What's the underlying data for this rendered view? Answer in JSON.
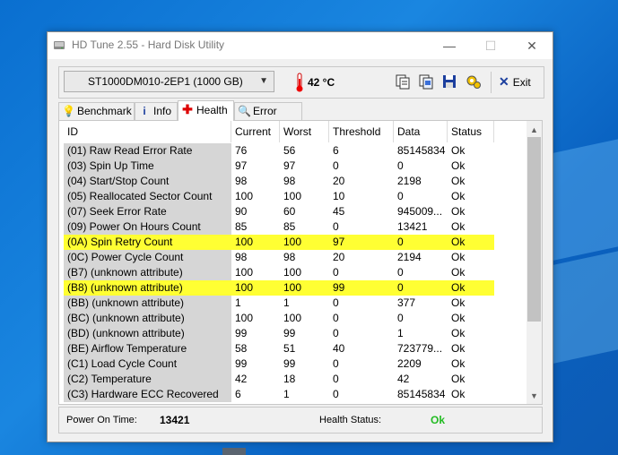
{
  "window": {
    "title": "HD Tune 2.55 - Hard Disk Utility",
    "minimize_glyph": "—",
    "maximize_glyph": "☐",
    "close_glyph": "✕"
  },
  "toolbar": {
    "drive": "ST1000DM010-2EP1 (1000 GB)",
    "temperature": "42 °C",
    "exit_label": "Exit",
    "icons": [
      "copy-text-icon",
      "copy-screenshot-icon",
      "save-icon",
      "options-icon"
    ]
  },
  "tabs": [
    {
      "label": "Benchmark",
      "icon": "lightbulb-icon"
    },
    {
      "label": "Info",
      "icon": "info-icon"
    },
    {
      "label": "Health",
      "icon": "health-cross-icon",
      "active": true
    },
    {
      "label": "Error Scan",
      "icon": "magnifier-icon"
    }
  ],
  "table": {
    "columns": [
      "ID",
      "Current",
      "Worst",
      "Threshold",
      "Data",
      "Status"
    ],
    "rows": [
      {
        "id": "(01) Raw Read Error Rate",
        "current": "76",
        "worst": "56",
        "threshold": "6",
        "data": "85145834",
        "status": "Ok"
      },
      {
        "id": "(03) Spin Up Time",
        "current": "97",
        "worst": "97",
        "threshold": "0",
        "data": "0",
        "status": "Ok"
      },
      {
        "id": "(04) Start/Stop Count",
        "current": "98",
        "worst": "98",
        "threshold": "20",
        "data": "2198",
        "status": "Ok"
      },
      {
        "id": "(05) Reallocated Sector Count",
        "current": "100",
        "worst": "100",
        "threshold": "10",
        "data": "0",
        "status": "Ok"
      },
      {
        "id": "(07) Seek Error Rate",
        "current": "90",
        "worst": "60",
        "threshold": "45",
        "data": "945009...",
        "status": "Ok"
      },
      {
        "id": "(09) Power On Hours Count",
        "current": "85",
        "worst": "85",
        "threshold": "0",
        "data": "13421",
        "status": "Ok"
      },
      {
        "id": "(0A) Spin Retry Count",
        "current": "100",
        "worst": "100",
        "threshold": "97",
        "data": "0",
        "status": "Ok",
        "highlight": true
      },
      {
        "id": "(0C) Power Cycle Count",
        "current": "98",
        "worst": "98",
        "threshold": "20",
        "data": "2194",
        "status": "Ok"
      },
      {
        "id": "(B7) (unknown attribute)",
        "current": "100",
        "worst": "100",
        "threshold": "0",
        "data": "0",
        "status": "Ok"
      },
      {
        "id": "(B8) (unknown attribute)",
        "current": "100",
        "worst": "100",
        "threshold": "99",
        "data": "0",
        "status": "Ok",
        "highlight": true
      },
      {
        "id": "(BB) (unknown attribute)",
        "current": "1",
        "worst": "1",
        "threshold": "0",
        "data": "377",
        "status": "Ok"
      },
      {
        "id": "(BC) (unknown attribute)",
        "current": "100",
        "worst": "100",
        "threshold": "0",
        "data": "0",
        "status": "Ok"
      },
      {
        "id": "(BD) (unknown attribute)",
        "current": "99",
        "worst": "99",
        "threshold": "0",
        "data": "1",
        "status": "Ok"
      },
      {
        "id": "(BE) Airflow Temperature",
        "current": "58",
        "worst": "51",
        "threshold": "40",
        "data": "723779...",
        "status": "Ok"
      },
      {
        "id": "(C1) Load Cycle Count",
        "current": "99",
        "worst": "99",
        "threshold": "0",
        "data": "2209",
        "status": "Ok"
      },
      {
        "id": "(C2) Temperature",
        "current": "42",
        "worst": "18",
        "threshold": "0",
        "data": "42",
        "status": "Ok"
      },
      {
        "id": "(C3) Hardware ECC Recovered",
        "current": "6",
        "worst": "1",
        "threshold": "0",
        "data": "85145834",
        "status": "Ok"
      }
    ]
  },
  "footer": {
    "power_on_label": "Power On Time:",
    "power_on_value": "13421",
    "health_label": "Health Status:",
    "health_value": "Ok"
  },
  "colors": {
    "highlight": "#ffff33",
    "health_ok": "#22bb22",
    "desktop": "#0a6fd0"
  }
}
